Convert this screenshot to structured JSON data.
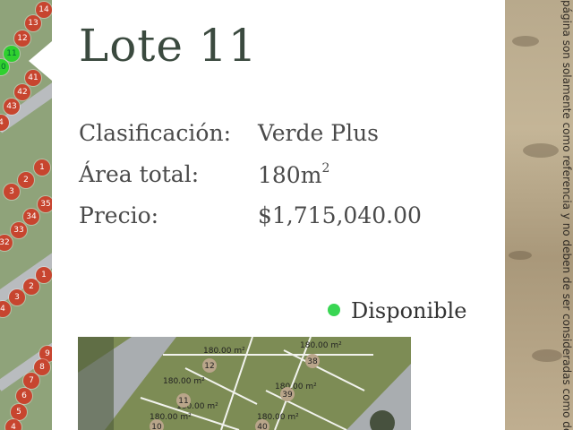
{
  "lot": {
    "title": "Lote 11",
    "classification_label": "Clasificación:",
    "classification_value": "Verde Plus",
    "area_label": "Área total:",
    "area_value": "180m",
    "area_unit_sup": "2",
    "price_label": "Precio:",
    "price_value": "$1,715,040.00",
    "status": "Disponible",
    "status_color": "#39d653"
  },
  "map_markers": [
    "14",
    "13",
    "12",
    "11",
    "10",
    "41",
    "42",
    "43",
    "4",
    "1",
    "2",
    "3",
    "34",
    "35",
    "33",
    "32",
    "1",
    "2",
    "3",
    "4",
    "9",
    "8",
    "7",
    "6",
    "5",
    "4"
  ],
  "plan": {
    "lot_numbers": [
      "12",
      "11",
      "38",
      "39",
      "10",
      "40"
    ],
    "areas": [
      "180.00 m²",
      "180.00 m²",
      "180.00 m²",
      "180.00 m²",
      "180.00 m²",
      "180.00 m²",
      "180.00 m²"
    ]
  },
  "disclaimer": "página son solamente como referencia y no deben de ser consideradas como de"
}
